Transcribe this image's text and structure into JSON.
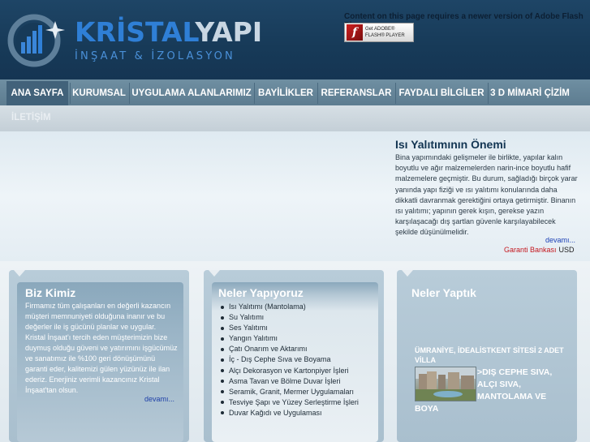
{
  "header": {
    "logo_name_part1": "KRİSTAL",
    "logo_name_part2": "YAPI",
    "logo_tagline": "İNŞAAT & İZOLASYON",
    "flash_notice": "Content on this page requires a newer version of Adobe Flash Player.",
    "flash_badge_line1": "Get ADOBE®",
    "flash_badge_line2": "FLASH® PLAYER"
  },
  "nav": {
    "items": [
      {
        "label": "ANA SAYFA"
      },
      {
        "label": "KURUMSAL"
      },
      {
        "label": "UYGULAMA ALANLARIMIZ"
      },
      {
        "label": "BAYİLİKLER"
      },
      {
        "label": "REFERANSLAR"
      },
      {
        "label": "FAYDALI BİLGİLER"
      },
      {
        "label": "3 D MİMARİ ÇİZİM"
      },
      {
        "label": "İLETİŞİM"
      }
    ],
    "active_index": 0
  },
  "hero": {
    "title": "Isı Yalıtımının Önemi",
    "text": "Bina yapımındaki gelişmeler ile birlikte, yapılar kalın boyutlu ve ağır malzemelerden narin-ince boyutlu hafif malzemelere geçmiştir. Bu durum, sağladığı birçok yarar yanında yapı fiziği ve ısı yalıtımı konularında daha dikkatli davranmak gerektiğini ortaya getirmiştir. Binanın ısı yalıtımı; yapının gerek kışın, gerekse yazın karşılaşacağı dış şartlan güvenle karşılayabilecek şekilde düşünülmelidir.",
    "more": "devamı...",
    "ticker_bank": "Garanti Bankası",
    "ticker_currency": "USD"
  },
  "about": {
    "title": "Biz Kimiz",
    "text": "Firmamız tüm çalışanları en değerli kazancın müşteri memnuniyeti olduğuna inanır ve bu değerler ile iş gücünü planlar ve uygular. Kristal İnşaat'ı tercih eden müşterimizin bize duymuş olduğu güveni ve yatırımını işgücümüz ve sanatımız ile %100 geri dönüşümünü garanti eder, kalitemizi gülen yüzünüz ile ilan ederiz. Enerjiniz verimli kazancınız Kristal İnşaat'tan olsun.",
    "more": "devamı..."
  },
  "services": {
    "title": "Neler Yapıyoruz",
    "items": [
      "Isı Yalıtımı (Mantolama)",
      "Su Yalıtımı",
      "Ses Yalıtımı",
      "Yangın Yalıtımı",
      "Çatı Onarım ve Aktarımı",
      "İç - Dış Cephe Sıva ve Boyama",
      "Alçı Dekorasyon ve Kartonpiyer İşleri",
      "Asma Tavan ve Bölme Duvar İşleri",
      "Seramik, Granit, Mermer Uygulamaları",
      "Tesviye Şapı ve Yüzey Serleştirme İşleri",
      "Duvar Kağıdı ve Uygulaması"
    ]
  },
  "projects": {
    "title": "Neler Yaptık",
    "item_title": "ÜMRANİYE, İDEALİSTKENT SİTESİ 2 ADET VİLLA",
    "desc_line1": ">DIŞ CEPHE SIVA,",
    "desc_line2": "ALÇI SIVA,",
    "desc_line3": "MANTOLAMA VE",
    "desc_line4": "BOYA"
  },
  "colors": {
    "header_bg": "#1a3f5f",
    "nav_bg": "#5d7c90",
    "nav_active": "#42627a",
    "brand_blue": "#2f7fd6",
    "box_bg": "#9ab4c6",
    "link_blue": "#1a3fb5",
    "ticker_red": "#c4181f"
  }
}
